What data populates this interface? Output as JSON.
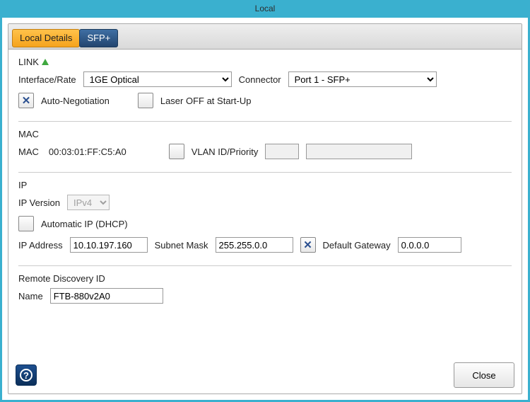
{
  "window": {
    "title": "Local"
  },
  "tabs": {
    "local_details": "Local Details",
    "sfp": "SFP+"
  },
  "link": {
    "title": "LINK",
    "interface_rate_label": "Interface/Rate",
    "interface_rate_value": "1GE Optical",
    "connector_label": "Connector",
    "connector_value": "Port 1 - SFP+",
    "auto_neg_label": "Auto-Negotiation",
    "laser_off_label": "Laser OFF at Start-Up"
  },
  "mac": {
    "title": "MAC",
    "mac_label": "MAC",
    "mac_value": "00:03:01:FF:C5:A0",
    "vlan_label": "VLAN ID/Priority",
    "vlan_a": "",
    "vlan_b": ""
  },
  "ip": {
    "title": "IP",
    "version_label": "IP Version",
    "version_value": "IPv4",
    "dhcp_label": "Automatic IP (DHCP)",
    "address_label": "IP Address",
    "address_value": "10.10.197.160",
    "subnet_label": "Subnet Mask",
    "subnet_value": "255.255.0.0",
    "gateway_label": "Default Gateway",
    "gateway_value": "0.0.0.0"
  },
  "remote": {
    "title": "Remote Discovery ID",
    "name_label": "Name",
    "name_value": "FTB-880v2A0"
  },
  "footer": {
    "close_label": "Close"
  }
}
